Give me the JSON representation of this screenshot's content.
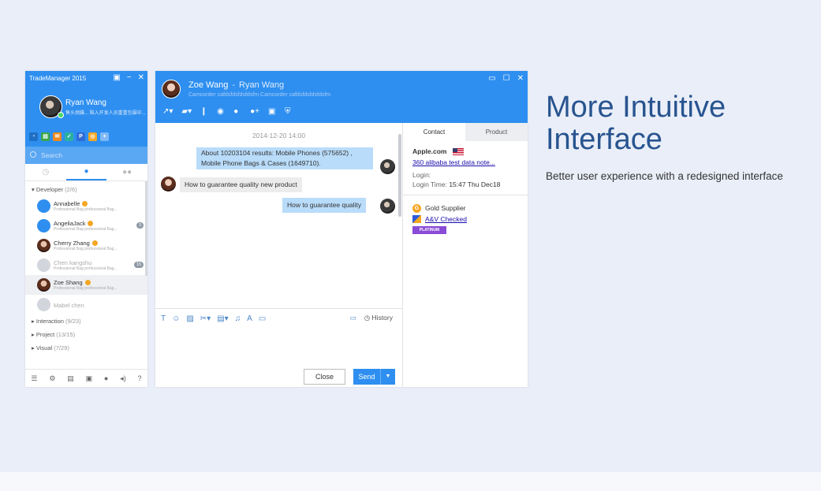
{
  "contact_window": {
    "title": "TradeManager 2015",
    "controls": [
      "▣",
      "−",
      "✕"
    ],
    "user_name": "Ryan Wang",
    "signature": "售头烦躁... 陷入开发人员重重包围中...",
    "search_placeholder": "Search",
    "groups": [
      {
        "name": "Developer",
        "count": "(2/6)"
      },
      {
        "name": "Interaction",
        "count": "(9/23)"
      },
      {
        "name": "Project",
        "count": "(13/15)"
      },
      {
        "name": "Visual",
        "count": "(7/29)"
      }
    ],
    "contacts": [
      {
        "name": "Annabelle",
        "sub": "Professional Bag professional Bag...",
        "badge": ""
      },
      {
        "name": "AngeliaJack",
        "sub": "Professional Bag professional Bag...",
        "badge": "3"
      },
      {
        "name": "Cherry Zhang",
        "sub": "Professional Bag professional Bag...",
        "badge": ""
      },
      {
        "name": "Chen kangshu",
        "sub": "Professional Bag professional Bag...",
        "badge": "15"
      },
      {
        "name": "Zoe Shang",
        "sub": "Professional Bag professional Bag...",
        "badge": ""
      },
      {
        "name": "Mabel chen",
        "sub": "",
        "badge": ""
      }
    ]
  },
  "chat_window": {
    "contact_name": "Zoe Wang",
    "separator": "-",
    "self_name": "Ryan Wang",
    "subtitle": "Camcorder cafdsfdsfdsfdsfm Camcorder cafdsfdsfdsfdsfm",
    "controls": [
      "▭",
      "☐",
      "✕"
    ],
    "timestamp": "2014-12-20  14:00",
    "messages": [
      {
        "from": "me",
        "line1": "About 10203104 results: Mobile Phones (575652) ,",
        "line2": "Mobile Phone Bags & Cases (1649710)."
      },
      {
        "from": "them",
        "line1": "How to guarantee quality new product"
      },
      {
        "from": "me",
        "line1": "How to guarantee quality"
      }
    ],
    "history_label": "History",
    "close_label": "Close",
    "send_label": "Send",
    "side_tabs": [
      "Contact",
      "Product"
    ],
    "company": "Apple.com",
    "note_link": "360 alibaba test data note...",
    "login_label": "Login:",
    "login_time_label": "Login Time:",
    "login_time": "15:47 Thu Dec18",
    "gold_supplier": "Gold Supplier",
    "av_checked": "A&V Checked",
    "platinum": "PLATINUM"
  },
  "marketing": {
    "headline_line1": "More Intuitive",
    "headline_line2": "Interface",
    "subline": "Better user experience with a redesigned interface"
  },
  "colors": {
    "accent": "#2e8ff0",
    "headline": "#28548f",
    "page_bg": "#e9eef8"
  }
}
